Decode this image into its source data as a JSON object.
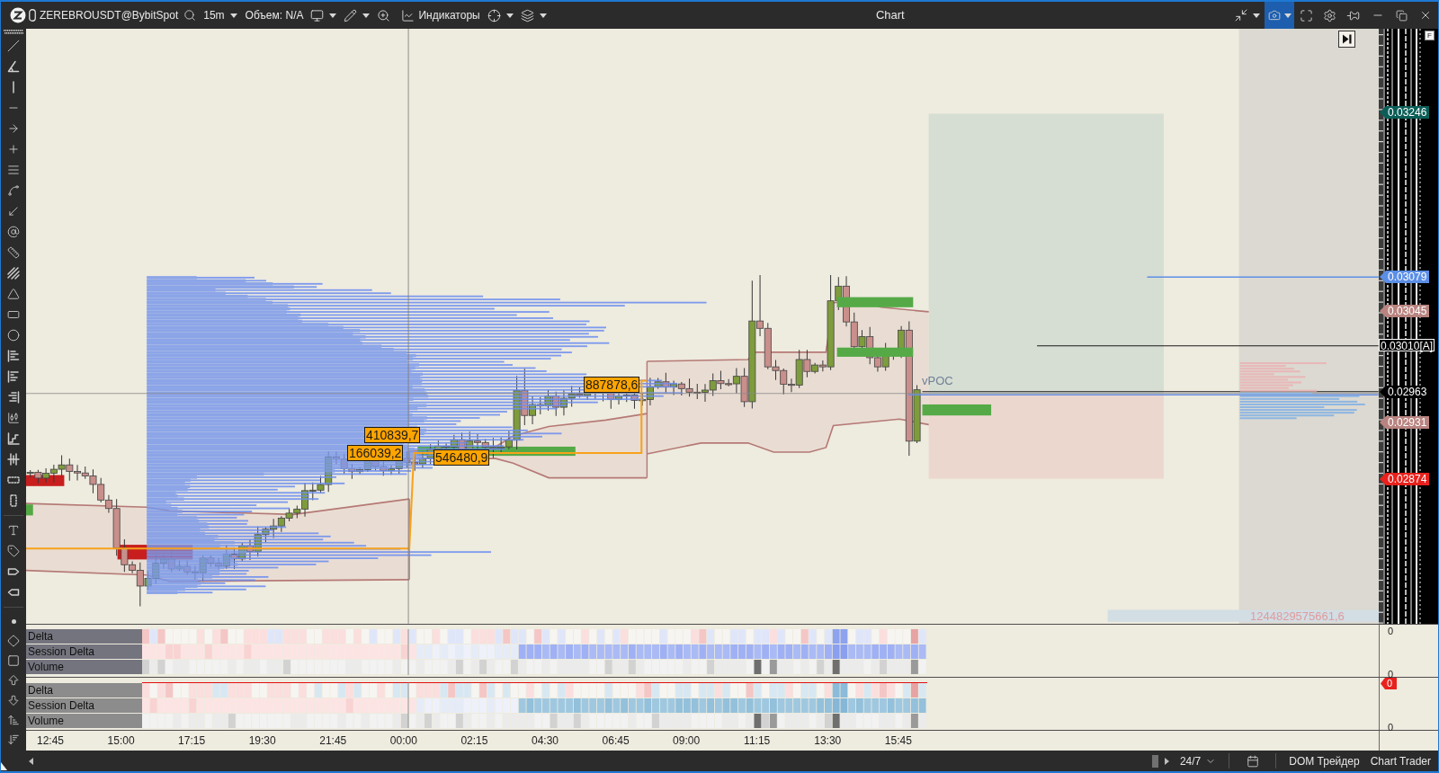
{
  "toolbar": {
    "symbol": "ZEREBROUSDT@BybitSpot",
    "timeframe": "15m",
    "volume": "Объем: N/A",
    "indicators": "Индикаторы"
  },
  "window": {
    "title": "Chart"
  },
  "window_controls": {
    "camera": {
      "selected": true
    }
  },
  "chart": {
    "axis_toggle": "F",
    "level_labels": [
      "887878,6",
      "410839,7",
      "166039,2",
      "546480,9"
    ],
    "poc_label": "vPOC",
    "total_volume": "1244829575661,6",
    "price_tags": [
      {
        "text": "0.03246",
        "color": "#0b5e57",
        "kind": "arrow"
      },
      {
        "text": "0.03079",
        "color": "#5b8ee6",
        "kind": "arrow"
      },
      {
        "text": "0.03045",
        "color": "#b98480",
        "kind": "arrow"
      },
      {
        "text": "0.03010[A]",
        "color": "#000000",
        "kind": "box"
      },
      {
        "text": "0.02963",
        "color": "#000000",
        "kind": "arrow"
      },
      {
        "text": "0.02931",
        "color": "#b98480",
        "kind": "arrow"
      },
      {
        "text": "0.02874",
        "color": "#e8211d",
        "kind": "arrow"
      }
    ]
  },
  "panels": [
    {
      "rows": [
        "Delta",
        "Session Delta",
        "Volume"
      ],
      "axis_labels": [
        "0",
        "0"
      ]
    },
    {
      "rows": [
        "Delta",
        "Session Delta",
        "Volume"
      ],
      "axis_badge": "0",
      "axis_labels": [
        "0"
      ]
    }
  ],
  "time_axis": [
    "12:45",
    "15:00",
    "17:15",
    "19:30",
    "21:45",
    "00:00",
    "02:15",
    "04:30",
    "06:45",
    "09:00",
    "11:15",
    "13:30",
    "15:45"
  ],
  "status_bar": {
    "session": "24/7",
    "buttons": [
      "DOM Трейдер",
      "Chart Trader"
    ]
  }
}
